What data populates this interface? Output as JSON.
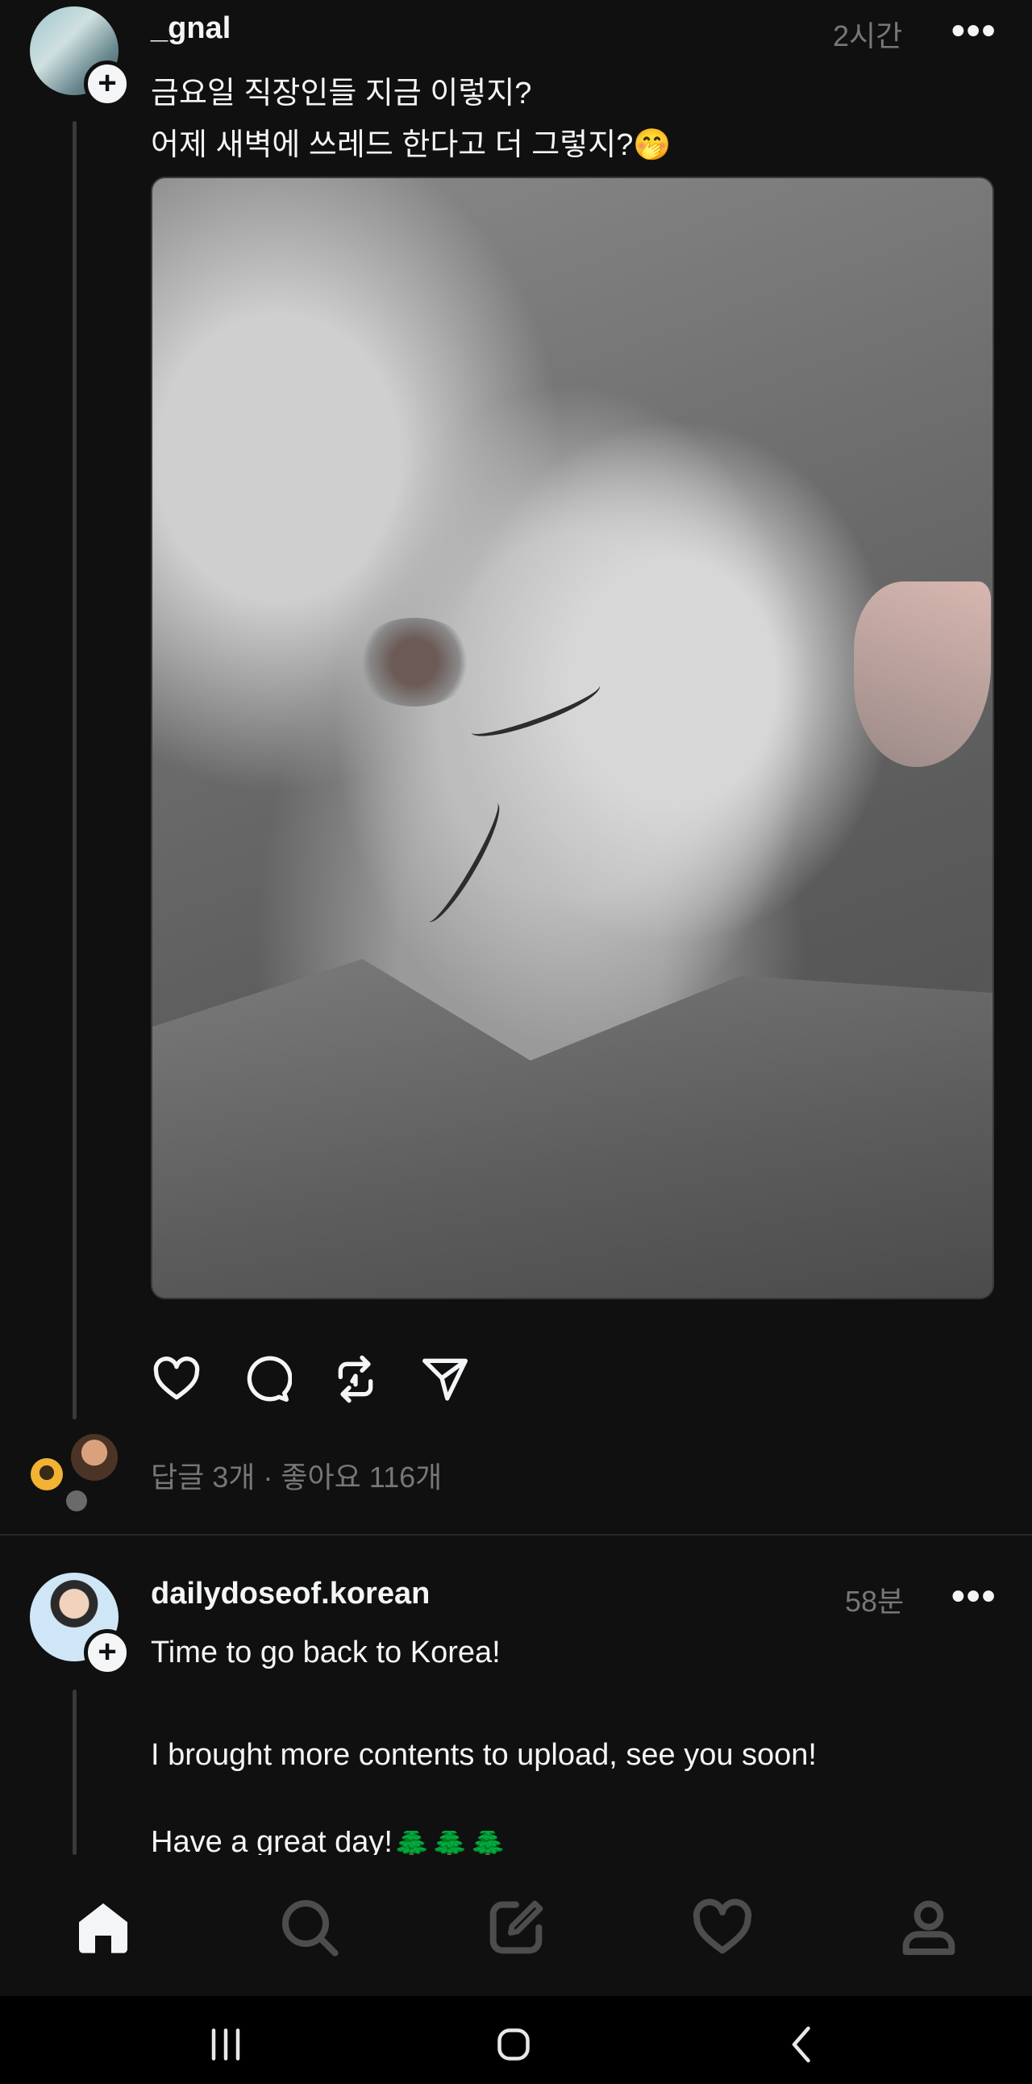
{
  "post1": {
    "username": "_gnal",
    "time": "2시간",
    "more_label": "•••",
    "lines": [
      "금요일 직장인들 지금 이렇지?",
      "어제 새벽에 쓰레드 한다고 더 그렇지?🤭"
    ],
    "image_icon": "sleeping-cat-photo",
    "stats": "답글 3개 · 좋아요 116개"
  },
  "post2": {
    "username": "dailydoseof.korean",
    "time": "58분",
    "more_label": "•••",
    "lines": [
      "Time to go back to Korea!",
      "",
      "I brought more contents to upload, see you soon!",
      "Have a great day!🌲🌲🌲"
    ]
  },
  "follow_label": "+",
  "actions": [
    "heart-icon",
    "comment-icon",
    "repost-icon",
    "share-icon"
  ],
  "tabs": [
    "home-icon",
    "search-icon",
    "compose-icon",
    "activity-heart-icon",
    "profile-icon"
  ],
  "system_nav": [
    "recent-apps-icon",
    "home-button-icon",
    "back-icon"
  ],
  "colors": {
    "background": "#101010",
    "text": "#f3f5f7",
    "muted": "#777777"
  }
}
